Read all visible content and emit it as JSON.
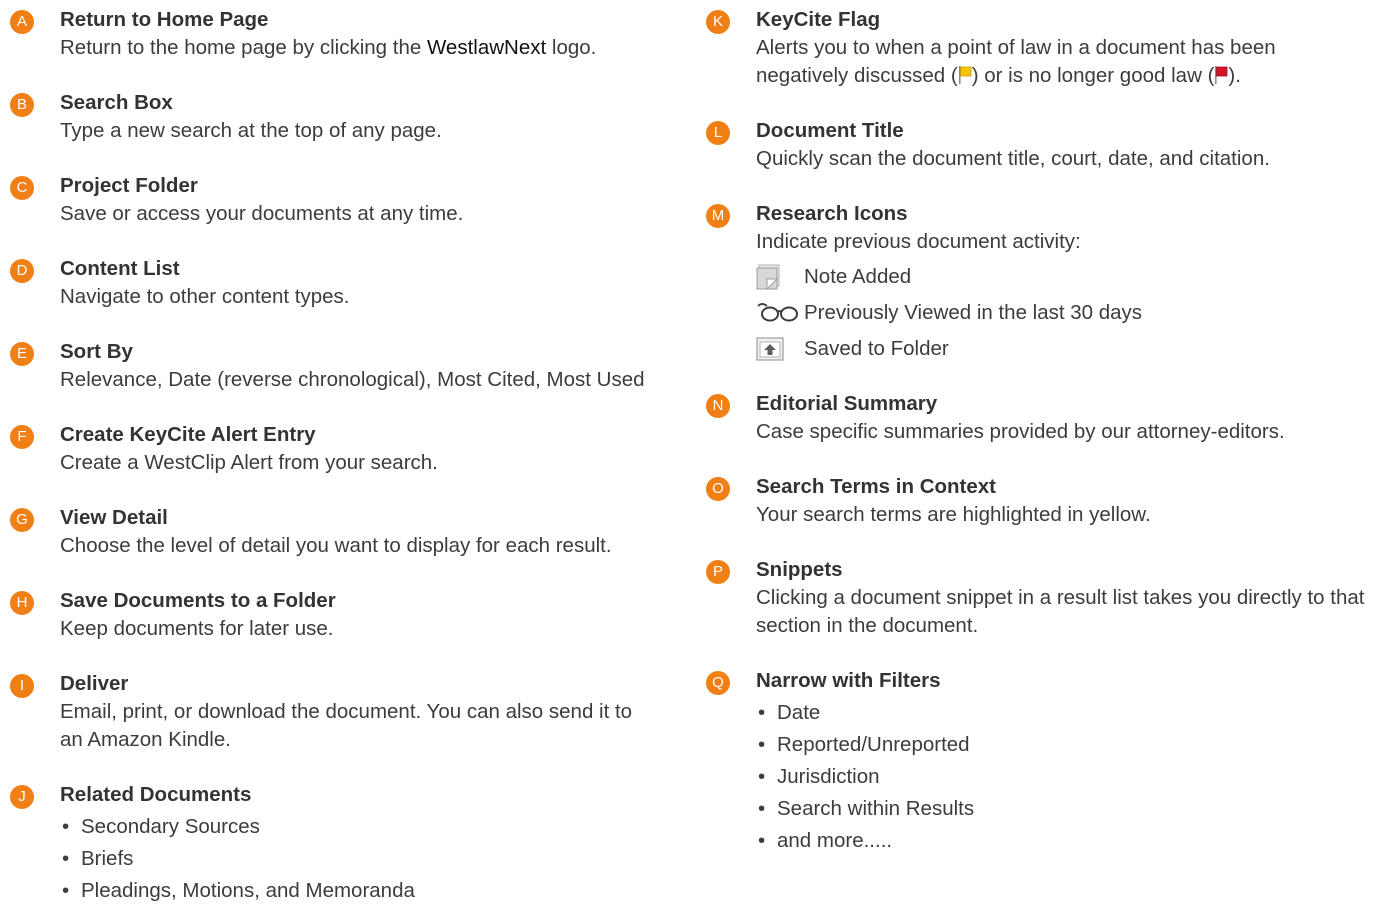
{
  "left": [
    {
      "letter": "A",
      "title": "Return to Home Page",
      "desc_before": "Return to the home page by clicking the ",
      "desc_brand": "WestlawNext",
      "desc_after": " logo."
    },
    {
      "letter": "B",
      "title": "Search Box",
      "desc": "Type a new search at the top of any page."
    },
    {
      "letter": "C",
      "title": "Project Folder",
      "desc": "Save or access your documents at any time."
    },
    {
      "letter": "D",
      "title": "Content List",
      "desc": "Navigate to other content types."
    },
    {
      "letter": "E",
      "title": "Sort By",
      "desc": "Relevance, Date (reverse chronological), Most Cited, Most Used"
    },
    {
      "letter": "F",
      "title": "Create KeyCite Alert Entry",
      "desc": "Create a WestClip Alert from your search."
    },
    {
      "letter": "G",
      "title": "View Detail",
      "desc": "Choose the level of detail you want to display for each result."
    },
    {
      "letter": "H",
      "title": "Save Documents to a Folder",
      "desc": "Keep documents for later use."
    },
    {
      "letter": "I",
      "title": "Deliver",
      "desc": "Email, print, or download the document. You can also send it to an Amazon Kindle."
    },
    {
      "letter": "J",
      "title": "Related Documents",
      "bullets": [
        "Secondary Sources",
        "Briefs",
        "Pleadings, Motions, and Memoranda"
      ]
    }
  ],
  "right": [
    {
      "letter": "K",
      "title": "KeyCite Flag",
      "desc_line1": "Alerts you to when a point of law in a document has been",
      "desc_line2_a": "negatively discussed (",
      "desc_line2_b": ") or is no longer good law (",
      "desc_line2_c": ")."
    },
    {
      "letter": "L",
      "title": "Document Title",
      "desc": "Quickly scan the document title, court, date, and citation."
    },
    {
      "letter": "M",
      "title": "Research Icons",
      "desc": "Indicate previous document activity:",
      "icons": [
        {
          "icon": "note-added-icon",
          "label": "Note Added"
        },
        {
          "icon": "glasses-icon",
          "label": "Previously Viewed in the last 30 days"
        },
        {
          "icon": "saved-folder-icon",
          "label": "Saved to Folder"
        }
      ]
    },
    {
      "letter": "N",
      "title": "Editorial Summary",
      "desc": "Case specific summaries provided by our attorney-editors."
    },
    {
      "letter": "O",
      "title": "Search Terms in Context",
      "desc": "Your search terms are highlighted in yellow."
    },
    {
      "letter": "P",
      "title": "Snippets",
      "desc": "Clicking a document snippet in a result list takes you directly to that section in the document."
    },
    {
      "letter": "Q",
      "title": "Narrow with Filters",
      "bullets": [
        "Date",
        "Reported/Unreported",
        "Jurisdiction",
        "Search within Results",
        "and more....."
      ]
    }
  ],
  "bullet_glyph": "•",
  "colors": {
    "badge": "#f07f16",
    "text": "#333333",
    "flag_yellow": "#f5c400",
    "flag_red": "#d6142a"
  }
}
